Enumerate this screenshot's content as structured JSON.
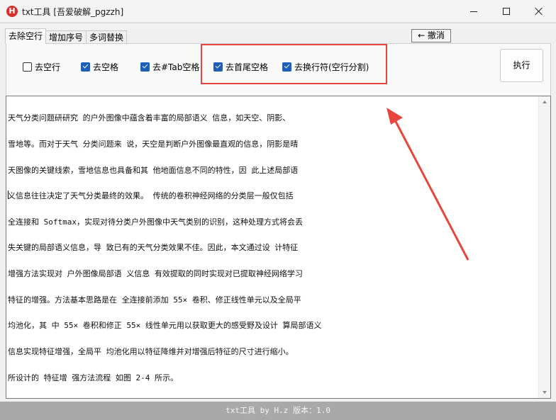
{
  "window": {
    "icon_letter": "H",
    "title": "txt工具 [吾爱破解_pgzzh]"
  },
  "tabs": [
    {
      "label": "去除空行",
      "active": true
    },
    {
      "label": "增加序号",
      "active": false
    },
    {
      "label": "多词替换",
      "active": false
    }
  ],
  "toolbar": {
    "undo_label": "← 撤消",
    "run_label": "执行"
  },
  "options": [
    {
      "label": "去空行",
      "checked": false
    },
    {
      "label": "去空格",
      "checked": true
    },
    {
      "label": "去#Tab空格",
      "checked": true
    },
    {
      "label": "去首尾空格",
      "checked": true
    },
    {
      "label": "去换行符(空行分割)",
      "checked": true
    }
  ],
  "editor": {
    "lines": [
      "天气分类问题研研究 的户外图像中蕴含着丰富的局部语义 信息，如天空、阴影、",
      "雪地等。而对于天气 分类问题来 说，天空是判断户外图像最直观的信息，阴影是晴",
      "天图像的关键线索，雪地信息也具备和其 他地面信息不同的特性，因 此上述局部语",
      "义信息往往决定了天气分类最终的效果。 传统的卷积神经网络的分类层一般仅包括",
      "全连接和 Softmax，实现对待分类户外图像中天气类别的识别，这种处理方式将会丢",
      "失关键的局部语义信息，导 致已有的天气分类效果不佳。因此，本文通过设 计特征",
      "增强方法实现对 户外图像局部语 义信息 有效提取的同时实现对已提取神经网络学习",
      "特征的增强。方法基本思路是在 全连接前添加 55× 卷积、修正线性单元以及全局平",
      "均池化，其 中 55× 卷积和修正 55× 线性单元用以获取更大的感受野及设计 算局部语义",
      "信息实现特征增强，全局平 均池化用以特征降维并对增强后特征的尺寸进行缩小。",
      "所设计的 特征增 强方法流程 如图 2-4 所示。"
    ]
  },
  "status": {
    "text": "txt工具 by H.z  版本：1.0"
  },
  "colors": {
    "highlight_box": "#e8453c",
    "checkbox_checked": "#1d5fb8",
    "status_bar": "#a9a9a9"
  }
}
